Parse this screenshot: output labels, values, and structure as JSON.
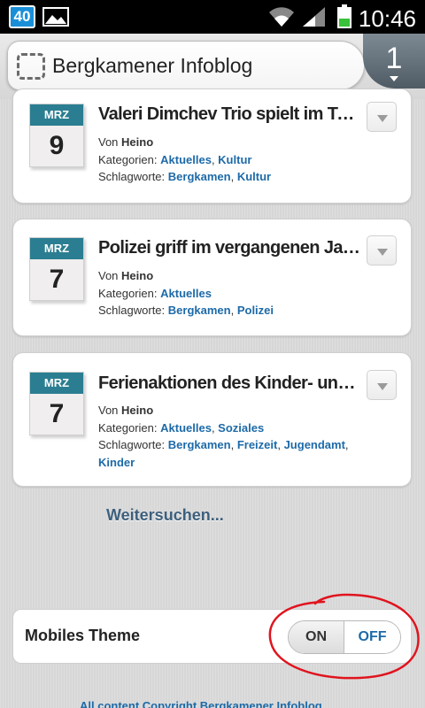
{
  "status_bar": {
    "badge": "40",
    "time": "10:46",
    "icons": [
      "gallery-icon",
      "wifi-icon",
      "signal-icon",
      "battery-icon"
    ]
  },
  "browser": {
    "page_title": "Bergkamener Infoblog",
    "tab_count": "1"
  },
  "posts": [
    {
      "month": "MRZ",
      "day": "9",
      "title": "Valeri Dimchev Trio spielt im Tra...",
      "by_label": "Von",
      "author": "Heino",
      "categories_label": "Kategorien:",
      "categories": [
        "Aktuelles",
        "Kultur"
      ],
      "tags_label": "Schlagworte:",
      "tags": [
        "Bergkamen",
        "Kultur"
      ]
    },
    {
      "month": "MRZ",
      "day": "7",
      "title": "Polizei griff im vergangenen Jah...",
      "by_label": "Von",
      "author": "Heino",
      "categories_label": "Kategorien:",
      "categories": [
        "Aktuelles"
      ],
      "tags_label": "Schlagworte:",
      "tags": [
        "Bergkamen",
        "Polizei"
      ]
    },
    {
      "month": "MRZ",
      "day": "7",
      "title": "Ferienaktionen des Kinder- und ...",
      "by_label": "Von",
      "author": "Heino",
      "categories_label": "Kategorien:",
      "categories": [
        "Aktuelles",
        "Soziales"
      ],
      "tags_label": "Schlagworte:",
      "tags": [
        "Bergkamen",
        "Freizeit",
        "Jugendamt",
        "Kinder"
      ]
    }
  ],
  "more_link": "Weitersuchen...",
  "theme": {
    "label": "Mobiles Theme",
    "on_label": "ON",
    "off_label": "OFF",
    "selected": "OFF"
  },
  "footer": "All content Copyright Bergkamener Infoblog",
  "colors": {
    "link": "#1d6aa8",
    "calendar_header": "#2b7e91",
    "annotation": "#e0141e"
  }
}
